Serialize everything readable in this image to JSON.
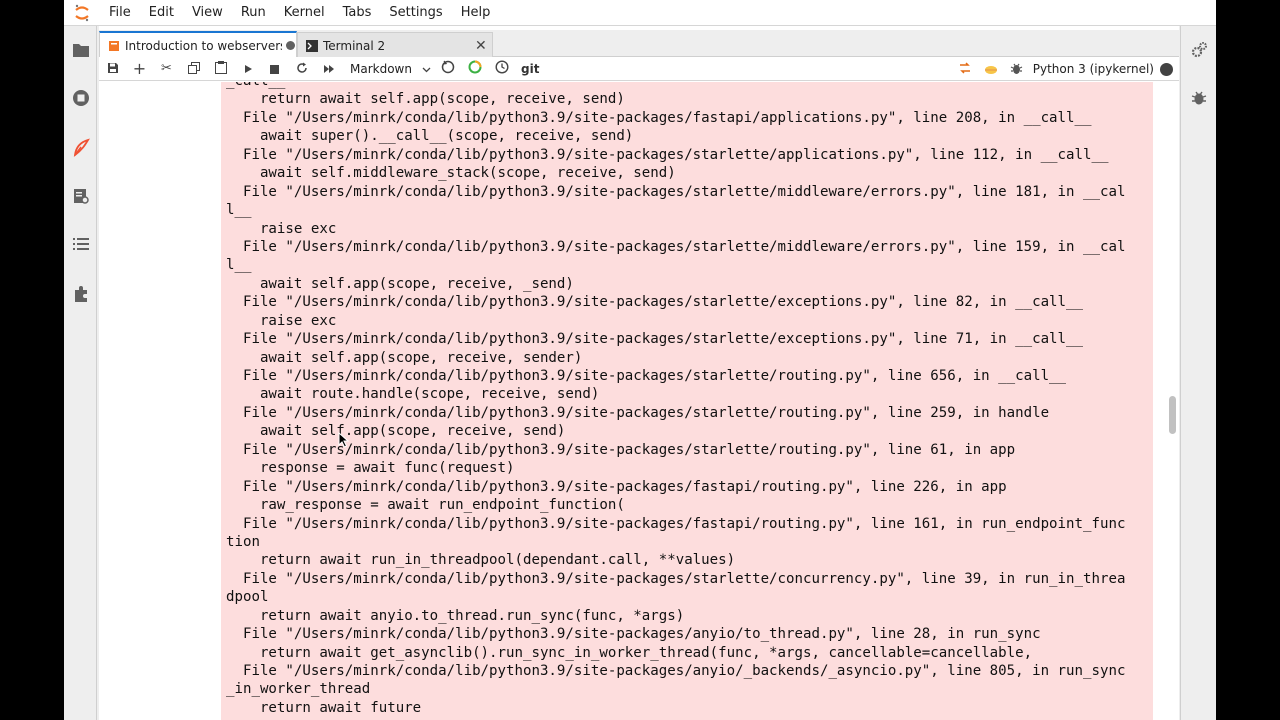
{
  "menu": [
    "File",
    "Edit",
    "View",
    "Run",
    "Kernel",
    "Tabs",
    "Settings",
    "Help"
  ],
  "tabs": [
    {
      "label": "Introduction to webservers.i",
      "active": true
    },
    {
      "label": "Terminal 2",
      "active": false
    }
  ],
  "toolbar": {
    "cell_type": "Markdown",
    "git_label": "git",
    "kernel_name": "Python 3 (ipykernel)"
  },
  "colors": {
    "accent": "#1976d2",
    "error_bg": "#fddddd",
    "jupyter_orange": "#f37726"
  },
  "traceback_lines": [
    "_call__",
    "    return await self.app(scope, receive, send)",
    "  File \"/Users/minrk/conda/lib/python3.9/site-packages/fastapi/applications.py\", line 208, in __call__",
    "    await super().__call__(scope, receive, send)",
    "  File \"/Users/minrk/conda/lib/python3.9/site-packages/starlette/applications.py\", line 112, in __call__",
    "    await self.middleware_stack(scope, receive, send)",
    "  File \"/Users/minrk/conda/lib/python3.9/site-packages/starlette/middleware/errors.py\", line 181, in __cal",
    "l__",
    "    raise exc",
    "  File \"/Users/minrk/conda/lib/python3.9/site-packages/starlette/middleware/errors.py\", line 159, in __cal",
    "l__",
    "    await self.app(scope, receive, _send)",
    "  File \"/Users/minrk/conda/lib/python3.9/site-packages/starlette/exceptions.py\", line 82, in __call__",
    "    raise exc",
    "  File \"/Users/minrk/conda/lib/python3.9/site-packages/starlette/exceptions.py\", line 71, in __call__",
    "    await self.app(scope, receive, sender)",
    "  File \"/Users/minrk/conda/lib/python3.9/site-packages/starlette/routing.py\", line 656, in __call__",
    "    await route.handle(scope, receive, send)",
    "  File \"/Users/minrk/conda/lib/python3.9/site-packages/starlette/routing.py\", line 259, in handle",
    "    await self.app(scope, receive, send)",
    "  File \"/Users/minrk/conda/lib/python3.9/site-packages/starlette/routing.py\", line 61, in app",
    "    response = await func(request)",
    "  File \"/Users/minrk/conda/lib/python3.9/site-packages/fastapi/routing.py\", line 226, in app",
    "    raw_response = await run_endpoint_function(",
    "  File \"/Users/minrk/conda/lib/python3.9/site-packages/fastapi/routing.py\", line 161, in run_endpoint_func",
    "tion",
    "    return await run_in_threadpool(dependant.call, **values)",
    "  File \"/Users/minrk/conda/lib/python3.9/site-packages/starlette/concurrency.py\", line 39, in run_in_threa",
    "dpool",
    "    return await anyio.to_thread.run_sync(func, *args)",
    "  File \"/Users/minrk/conda/lib/python3.9/site-packages/anyio/to_thread.py\", line 28, in run_sync",
    "    return await get_asynclib().run_sync_in_worker_thread(func, *args, cancellable=cancellable,",
    "  File \"/Users/minrk/conda/lib/python3.9/site-packages/anyio/_backends/_asyncio.py\", line 805, in run_sync",
    "_in_worker_thread",
    "    return await future"
  ]
}
